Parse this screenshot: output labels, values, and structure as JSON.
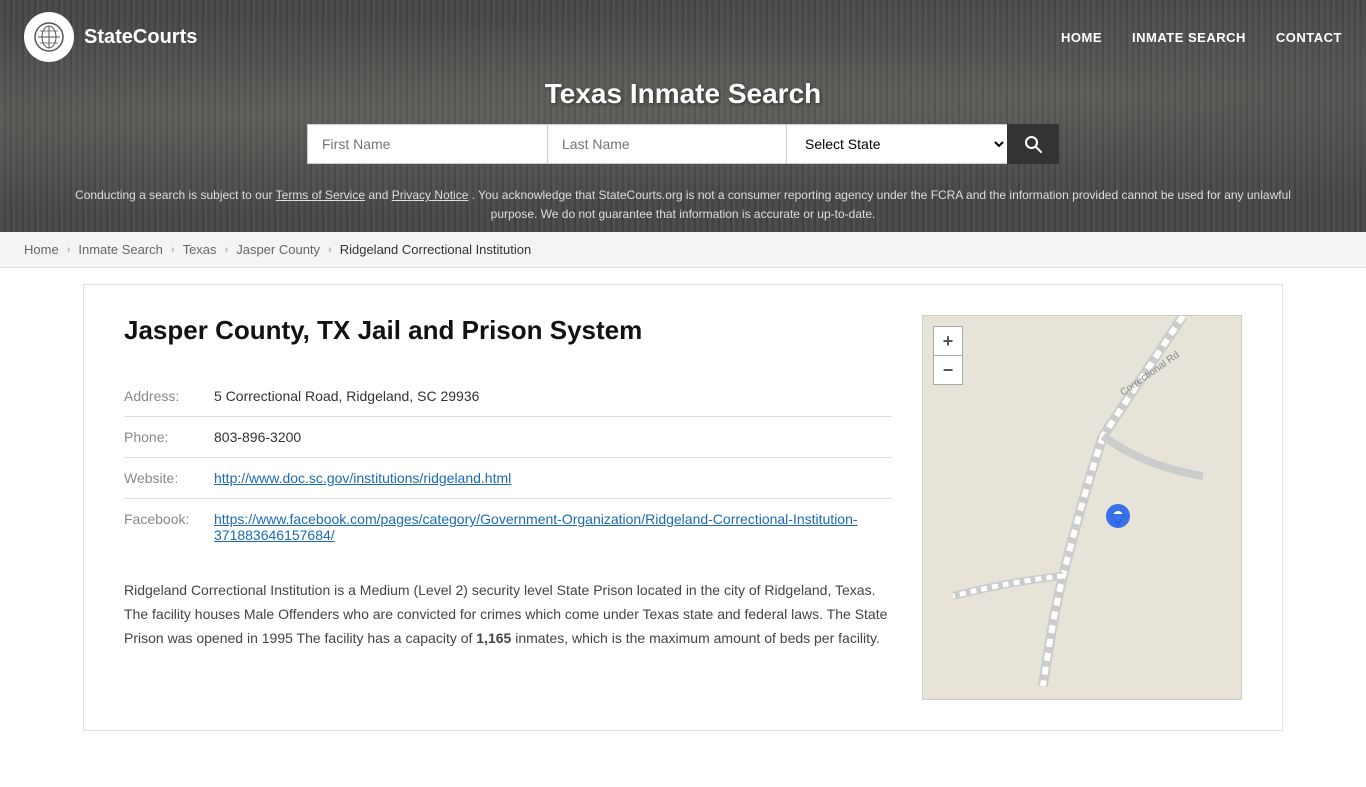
{
  "site": {
    "logo_text": "StateCourts",
    "logo_icon": "🏛"
  },
  "nav": {
    "home": "HOME",
    "inmate_search": "INMATE SEARCH",
    "contact": "CONTACT"
  },
  "header": {
    "title": "Texas Inmate Search"
  },
  "search": {
    "first_name_placeholder": "First Name",
    "last_name_placeholder": "Last Name",
    "state_placeholder": "Select State",
    "search_icon": "🔍"
  },
  "disclaimer": {
    "text_before": "Conducting a search is subject to our ",
    "terms_label": "Terms of Service",
    "and": " and ",
    "privacy_label": "Privacy Notice",
    "text_after": ". You acknowledge that StateCourts.org is not a consumer reporting agency under the FCRA and the information provided cannot be used for any unlawful purpose. We do not guarantee that information is accurate or up-to-date."
  },
  "breadcrumb": {
    "home": "Home",
    "inmate_search": "Inmate Search",
    "state": "Texas",
    "county": "Jasper County",
    "current": "Ridgeland Correctional Institution"
  },
  "institution": {
    "heading": "Jasper County, TX Jail and Prison System",
    "address_label": "Address:",
    "address_value": "5 Correctional Road, Ridgeland, SC 29936",
    "phone_label": "Phone:",
    "phone_value": "803-896-3200",
    "website_label": "Website:",
    "website_url": "http://www.doc.sc.gov/institutions/ridgeland.html",
    "website_display": "http://www.doc.sc.gov/institutions/ridgeland.html",
    "facebook_label": "Facebook:",
    "facebook_url": "https://www.facebook.com/pages/category/Government-Organization/Ridgeland-Correctional-Institution-371883646157684/",
    "facebook_display": "https://www.facebook.com/pages/category/Government-Organization/Ridgeland-Correctional-Institution-371883646157684/",
    "description": "Ridgeland Correctional Institution is a Medium (Level 2) security level State Prison located in the city of Ridgeland, Texas. The facility houses Male Offenders who are convicted for crimes which come under Texas state and federal laws. The State Prison was opened in 1995 The facility has a capacity of ",
    "capacity": "1,165",
    "description_end": " inmates, which is the maximum amount of beds per facility."
  },
  "map": {
    "zoom_in": "+",
    "zoom_out": "−",
    "road_label": "Correctional Rd"
  }
}
